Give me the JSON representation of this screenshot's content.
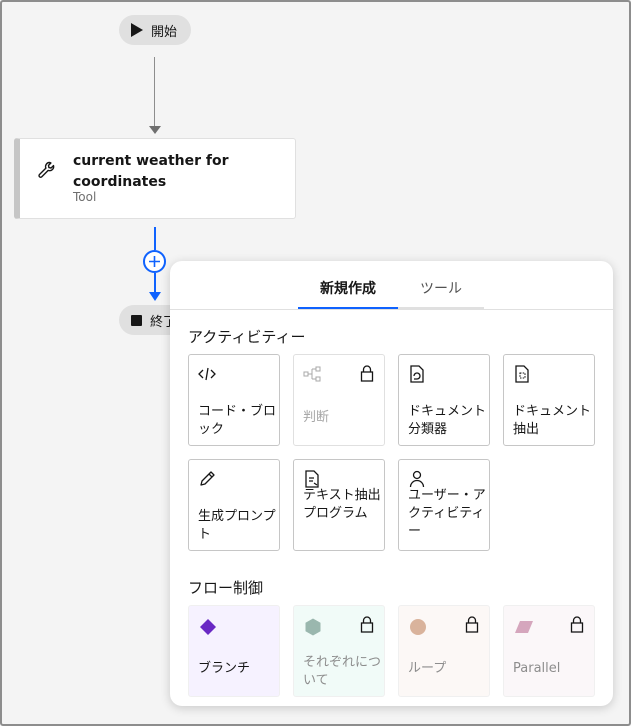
{
  "canvas": {
    "start_label": "開始",
    "end_label": "終了",
    "tool_card": {
      "title": "current weather for coordinates",
      "subtitle": "Tool",
      "icon": "wrench-icon"
    }
  },
  "panel": {
    "tabs": [
      {
        "label": "新規作成",
        "active": true
      },
      {
        "label": "ツール",
        "active": false
      }
    ],
    "activities": {
      "title": "アクティビティー",
      "items": [
        {
          "label": "コード・ブロック",
          "icon": "code-icon",
          "locked": false
        },
        {
          "label": "判断",
          "icon": "decision-icon",
          "locked": true
        },
        {
          "label": "ドキュメント分類器",
          "icon": "document-classifier-icon",
          "locked": false
        },
        {
          "label": "ドキュメント抽出",
          "icon": "document-extract-icon",
          "locked": false
        },
        {
          "label": "生成プロンプト",
          "icon": "generative-prompt-icon",
          "locked": false
        },
        {
          "label": "テキスト抽出プログラム",
          "icon": "text-extractor-icon",
          "locked": false
        },
        {
          "label": "ユーザー・アクティビティー",
          "icon": "user-icon",
          "locked": false
        }
      ]
    },
    "flow_control": {
      "title": "フロー制御",
      "items": [
        {
          "label": "ブランチ",
          "icon": "diamond-icon",
          "color": "#6929c4",
          "bg": "#f6f2ff",
          "locked": false
        },
        {
          "label": "それぞれについて",
          "icon": "hexagon-icon",
          "color": "#9ab7ae",
          "bg": "#f1fbf8",
          "locked": true
        },
        {
          "label": "ループ",
          "icon": "circle-icon",
          "color": "#d9b39c",
          "bg": "#fcf8f6",
          "locked": true
        },
        {
          "label": "Parallel",
          "icon": "parallelogram-icon",
          "color": "#d5a6bd",
          "bg": "#fbf7f9",
          "locked": true
        }
      ]
    }
  }
}
